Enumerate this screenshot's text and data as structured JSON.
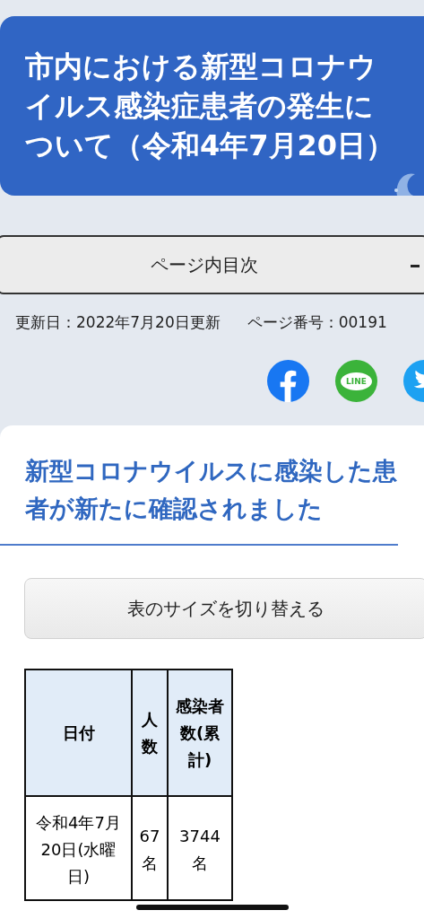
{
  "page_title": "市内における新型コロナウイルス感染症患者の発生について（令和4年7月20日）",
  "toc_button": {
    "label": "ページ内目次"
  },
  "meta": {
    "updated": "更新日：2022年7月20日更新",
    "page_number": "ページ番号：00191"
  },
  "share": [
    {
      "kind": "facebook"
    },
    {
      "kind": "line",
      "label": "LINE"
    },
    {
      "kind": "twitter"
    }
  ],
  "section_heading": "新型コロナウイルスに感染した患者が新たに確認されました",
  "table_size_button": "表のサイズを切り替える",
  "table": {
    "columns": [
      "日付",
      "人数",
      "感染者数(累計)"
    ],
    "rows": [
      [
        "令和4年7月20日(水曜日)",
        "67名",
        "3744名"
      ]
    ]
  }
}
